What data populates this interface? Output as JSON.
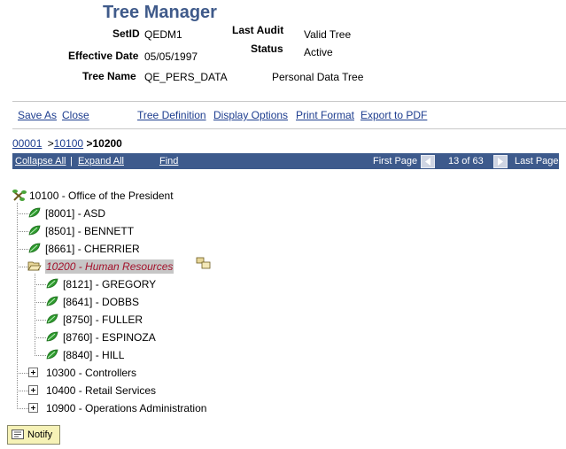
{
  "header": {
    "title": "Tree Manager",
    "setid_label": "SetID",
    "setid_value": "QEDM1",
    "effective_date_label": "Effective Date",
    "effective_date_value": "05/05/1997",
    "tree_name_label": "Tree Name",
    "tree_name_value": "QE_PERS_DATA",
    "tree_description": "Personal Data Tree",
    "last_audit_label": "Last Audit",
    "last_audit_value": "Valid Tree",
    "status_label": "Status",
    "status_value": "Active"
  },
  "actions": {
    "save_as": "Save As",
    "close": "Close",
    "tree_definition": "Tree Definition",
    "display_options": "Display Options",
    "print_format": "Print Format",
    "export_to_pdf": "Export to PDF"
  },
  "breadcrumb": {
    "items": [
      "00001",
      "10100"
    ],
    "current": "10200",
    "separator": ">"
  },
  "navbar": {
    "collapse_all": "Collapse All",
    "separator": "|",
    "expand_all": "Expand All",
    "find": "Find",
    "first_page": "First Page",
    "page_info": "13 of 63",
    "last_page": "Last Page"
  },
  "tree": {
    "root": "10100 - Office of the President",
    "nodes": [
      "[8001] - ASD",
      "[8501] - BENNETT",
      "[8661] - CHERRIER",
      "10200 - Human Resources",
      "[8121] - GREGORY",
      "[8641] - DOBBS",
      "[8750] - FULLER",
      "[8760] - ESPINOZA",
      "[8840] - HILL",
      "10300 - Controllers",
      "10400 - Retail Services",
      "10900 - Operations Administration"
    ]
  },
  "footer": {
    "notify": "Notify"
  },
  "colors": {
    "title": "#3f5a8a",
    "navbar_bg": "#3d5a8c",
    "link": "#1d3d8f",
    "selected_bg": "#c6c6c6",
    "selected_text": "#a3112b",
    "leaf_green": "#2e9a2e",
    "notify_bg": "#f6f2b7"
  }
}
